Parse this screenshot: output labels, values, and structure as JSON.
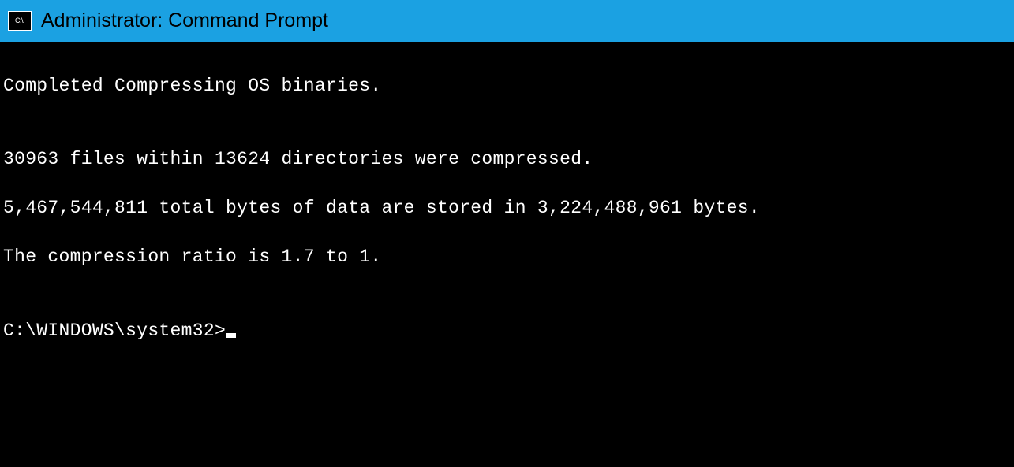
{
  "titlebar": {
    "icon_label": "C:\\.",
    "title": "Administrator: Command Prompt"
  },
  "terminal": {
    "line1": "Completed Compressing OS binaries.",
    "blank1": "",
    "line2": "30963 files within 13624 directories were compressed.",
    "line3": "5,467,544,811 total bytes of data are stored in 3,224,488,961 bytes.",
    "line4": "The compression ratio is 1.7 to 1.",
    "blank2": "",
    "prompt": "C:\\WINDOWS\\system32>"
  }
}
